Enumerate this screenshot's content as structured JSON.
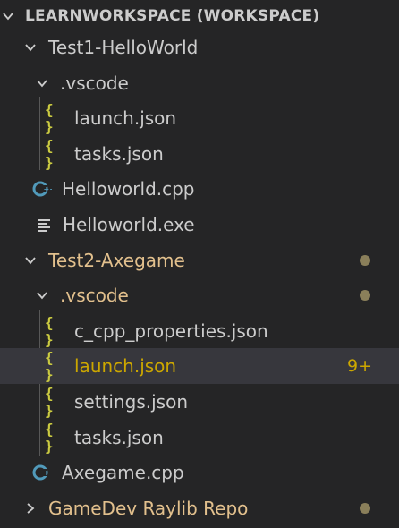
{
  "workspace": {
    "title": "LEARNWORKSPACE (WORKSPACE)"
  },
  "tree": {
    "test1": {
      "name": "Test1-HelloWorld",
      "vscode": {
        "name": ".vscode",
        "files": [
          "launch.json",
          "tasks.json"
        ]
      },
      "files": [
        "Helloworld.cpp",
        "Helloworld.exe"
      ]
    },
    "test2": {
      "name": "Test2-Axegame",
      "vscode": {
        "name": ".vscode",
        "files": [
          "c_cpp_properties.json",
          "launch.json",
          "settings.json",
          "tasks.json"
        ],
        "launch_badge": "9+"
      },
      "files": [
        "Axegame.cpp"
      ]
    },
    "gamedev": {
      "name": "GameDev Raylib Repo"
    }
  },
  "icons": {
    "json_glyph": "{ }",
    "cpp": "cpp-file-icon",
    "exe": "binary-file-icon"
  },
  "colors": {
    "background": "#252526",
    "selected_row": "#37373d",
    "modified_text": "#e2c08d",
    "error_text": "#cca700",
    "json_icon": "#cbcb41",
    "cpp_icon": "#519aba",
    "dot": "#8a7f5a"
  }
}
